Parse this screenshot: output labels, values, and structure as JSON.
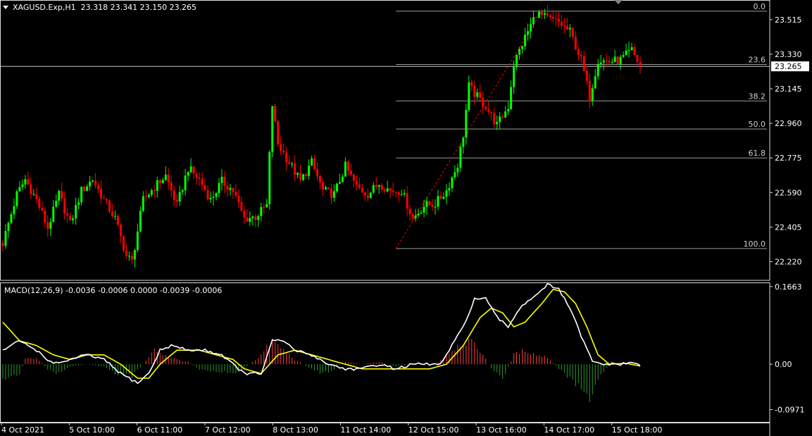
{
  "symbol_header": {
    "symbol": "XAGUSD.Exp,H1",
    "ohlc": "23.318 23.341 23.150 23.265"
  },
  "macd_header": {
    "label": "MACD(12,26,9)",
    "values": "-0.0036 -0.0006 0.0000 -0.0039 -0.0006"
  },
  "colors": {
    "background": "#000000",
    "bull": "#00ff00",
    "bear": "#ff0000",
    "grid_line": "#c8c8c8",
    "fib_line": "#9a9a9a",
    "signal_line": "#ffff00",
    "macd_line": "#ffffff",
    "hist_pos": "#ff3b3b",
    "hist_neg": "#2e9a2e"
  },
  "chart_data": [
    {
      "type": "candlestick",
      "ylim": [
        22.12,
        23.62
      ],
      "y_ticks": [
        "23.515",
        "23.330",
        "23.145",
        "22.960",
        "22.775",
        "22.590",
        "22.405",
        "22.220"
      ],
      "current_price": "23.265",
      "x_labels": [
        "4 Oct 2021",
        "5 Oct 10:00",
        "6 Oct 11:00",
        "7 Oct 12:00",
        "8 Oct 13:00",
        "11 Oct 14:00",
        "12 Oct 15:00",
        "13 Oct 16:00",
        "14 Oct 17:00",
        "15 Oct 18:00"
      ],
      "anchors": [
        [
          0,
          22.32
        ],
        [
          5,
          22.58
        ],
        [
          8,
          22.66
        ],
        [
          12,
          22.55
        ],
        [
          16,
          22.4
        ],
        [
          20,
          22.58
        ],
        [
          24,
          22.42
        ],
        [
          28,
          22.6
        ],
        [
          32,
          22.66
        ],
        [
          36,
          22.55
        ],
        [
          40,
          22.45
        ],
        [
          44,
          22.25
        ],
        [
          46,
          22.22
        ],
        [
          50,
          22.55
        ],
        [
          54,
          22.62
        ],
        [
          58,
          22.68
        ],
        [
          62,
          22.52
        ],
        [
          66,
          22.72
        ],
        [
          70,
          22.66
        ],
        [
          74,
          22.55
        ],
        [
          78,
          22.65
        ],
        [
          82,
          22.6
        ],
        [
          86,
          22.45
        ],
        [
          90,
          22.46
        ],
        [
          94,
          22.52
        ],
        [
          96,
          23.06
        ],
        [
          98,
          22.85
        ],
        [
          102,
          22.75
        ],
        [
          106,
          22.65
        ],
        [
          110,
          22.75
        ],
        [
          114,
          22.6
        ],
        [
          118,
          22.58
        ],
        [
          122,
          22.73
        ],
        [
          126,
          22.62
        ],
        [
          130,
          22.58
        ],
        [
          134,
          22.64
        ],
        [
          138,
          22.6
        ],
        [
          142,
          22.6
        ],
        [
          146,
          22.45
        ],
        [
          150,
          22.52
        ],
        [
          154,
          22.53
        ],
        [
          158,
          22.6
        ],
        [
          162,
          22.74
        ],
        [
          164,
          22.9
        ],
        [
          166,
          23.16
        ],
        [
          168,
          23.12
        ],
        [
          172,
          23.05
        ],
        [
          176,
          22.95
        ],
        [
          180,
          23.05
        ],
        [
          182,
          23.28
        ],
        [
          186,
          23.42
        ],
        [
          190,
          23.55
        ],
        [
          194,
          23.52
        ],
        [
          198,
          23.5
        ],
        [
          202,
          23.45
        ],
        [
          206,
          23.3
        ],
        [
          209,
          23.1
        ],
        [
          212,
          23.3
        ],
        [
          216,
          23.29
        ],
        [
          220,
          23.3
        ],
        [
          224,
          23.35
        ],
        [
          227,
          23.265
        ]
      ],
      "fibonacci": {
        "levels": [
          {
            "label": "0.0",
            "price": 23.56
          },
          {
            "label": "23.6",
            "price": 23.275
          },
          {
            "label": "38.2",
            "price": 23.08
          },
          {
            "label": "50.0",
            "price": 22.93
          },
          {
            "label": "61.8",
            "price": 22.775
          },
          {
            "label": "100.0",
            "price": 22.29
          }
        ],
        "trend_from_price": 22.29,
        "trend_to_price": 23.56
      }
    },
    {
      "type": "macd",
      "name": "MACD(12,26,9)",
      "ylim": [
        -0.125,
        0.175
      ],
      "y_ticks": [
        "0.1663",
        "0.00",
        "-0.0971"
      ],
      "macd_anchors": [
        [
          0,
          0.03
        ],
        [
          6,
          0.05
        ],
        [
          12,
          0.03
        ],
        [
          18,
          0.0
        ],
        [
          24,
          0.01
        ],
        [
          30,
          0.02
        ],
        [
          36,
          0.01
        ],
        [
          42,
          -0.02
        ],
        [
          48,
          -0.04
        ],
        [
          52,
          -0.02
        ],
        [
          56,
          0.03
        ],
        [
          60,
          0.04
        ],
        [
          66,
          0.03
        ],
        [
          72,
          0.03
        ],
        [
          78,
          0.02
        ],
        [
          82,
          0.0
        ],
        [
          86,
          -0.02
        ],
        [
          92,
          -0.02
        ],
        [
          96,
          0.05
        ],
        [
          100,
          0.05
        ],
        [
          104,
          0.03
        ],
        [
          110,
          0.02
        ],
        [
          116,
          0.0
        ],
        [
          122,
          -0.01
        ],
        [
          128,
          -0.01
        ],
        [
          134,
          0.0
        ],
        [
          140,
          -0.01
        ],
        [
          146,
          0.0
        ],
        [
          152,
          0.0
        ],
        [
          156,
          0.0
        ],
        [
          160,
          0.04
        ],
        [
          164,
          0.08
        ],
        [
          168,
          0.14
        ],
        [
          172,
          0.14
        ],
        [
          176,
          0.1
        ],
        [
          180,
          0.08
        ],
        [
          184,
          0.12
        ],
        [
          190,
          0.15
        ],
        [
          194,
          0.17
        ],
        [
          198,
          0.16
        ],
        [
          202,
          0.12
        ],
        [
          206,
          0.06
        ],
        [
          210,
          0.005
        ],
        [
          214,
          0.0
        ],
        [
          220,
          0.0
        ],
        [
          224,
          0.003
        ],
        [
          227,
          -0.0006
        ]
      ],
      "signal_anchors": [
        [
          0,
          0.09
        ],
        [
          6,
          0.05
        ],
        [
          12,
          0.04
        ],
        [
          18,
          0.02
        ],
        [
          24,
          0.01
        ],
        [
          30,
          0.02
        ],
        [
          36,
          0.02
        ],
        [
          42,
          0.0
        ],
        [
          48,
          -0.03
        ],
        [
          52,
          -0.03
        ],
        [
          56,
          0.0
        ],
        [
          62,
          0.03
        ],
        [
          70,
          0.03
        ],
        [
          76,
          0.02
        ],
        [
          82,
          0.01
        ],
        [
          86,
          -0.01
        ],
        [
          92,
          -0.02
        ],
        [
          98,
          0.02
        ],
        [
          104,
          0.03
        ],
        [
          110,
          0.02
        ],
        [
          116,
          0.01
        ],
        [
          122,
          0.0
        ],
        [
          128,
          -0.01
        ],
        [
          134,
          -0.01
        ],
        [
          140,
          -0.01
        ],
        [
          146,
          -0.01
        ],
        [
          152,
          -0.01
        ],
        [
          158,
          0.0
        ],
        [
          164,
          0.04
        ],
        [
          170,
          0.1
        ],
        [
          174,
          0.12
        ],
        [
          178,
          0.11
        ],
        [
          182,
          0.08
        ],
        [
          186,
          0.09
        ],
        [
          192,
          0.13
        ],
        [
          196,
          0.16
        ],
        [
          200,
          0.155
        ],
        [
          204,
          0.13
        ],
        [
          208,
          0.08
        ],
        [
          212,
          0.02
        ],
        [
          216,
          0.0
        ],
        [
          222,
          0.002
        ],
        [
          227,
          -0.0039
        ]
      ],
      "hist_anchors": [
        [
          0,
          -0.03
        ],
        [
          6,
          -0.02
        ],
        [
          8,
          0.01
        ],
        [
          12,
          0.015
        ],
        [
          16,
          -0.01
        ],
        [
          20,
          -0.02
        ],
        [
          24,
          -0.005
        ],
        [
          30,
          0.0
        ],
        [
          36,
          -0.005
        ],
        [
          40,
          -0.02
        ],
        [
          46,
          -0.025
        ],
        [
          50,
          0.0
        ],
        [
          54,
          0.03
        ],
        [
          58,
          0.02
        ],
        [
          62,
          0.01
        ],
        [
          66,
          0.005
        ],
        [
          70,
          -0.01
        ],
        [
          76,
          -0.015
        ],
        [
          82,
          -0.02
        ],
        [
          86,
          -0.01
        ],
        [
          92,
          0.02
        ],
        [
          96,
          0.05
        ],
        [
          100,
          0.03
        ],
        [
          104,
          0.01
        ],
        [
          110,
          -0.01
        ],
        [
          114,
          -0.02
        ],
        [
          118,
          -0.01
        ],
        [
          122,
          0.005
        ],
        [
          128,
          0.0
        ],
        [
          134,
          0.005
        ],
        [
          140,
          -0.005
        ],
        [
          146,
          0.0
        ],
        [
          150,
          0.0
        ],
        [
          154,
          0.0
        ],
        [
          158,
          0.02
        ],
        [
          162,
          0.04
        ],
        [
          166,
          0.05
        ],
        [
          170,
          0.03
        ],
        [
          174,
          -0.01
        ],
        [
          178,
          -0.03
        ],
        [
          182,
          0.02
        ],
        [
          186,
          0.03
        ],
        [
          190,
          0.02
        ],
        [
          194,
          0.015
        ],
        [
          198,
          -0.01
        ],
        [
          202,
          -0.03
        ],
        [
          206,
          -0.05
        ],
        [
          209,
          -0.07
        ],
        [
          212,
          -0.03
        ],
        [
          216,
          0.0
        ],
        [
          222,
          0.002
        ],
        [
          227,
          0.0
        ]
      ]
    }
  ]
}
